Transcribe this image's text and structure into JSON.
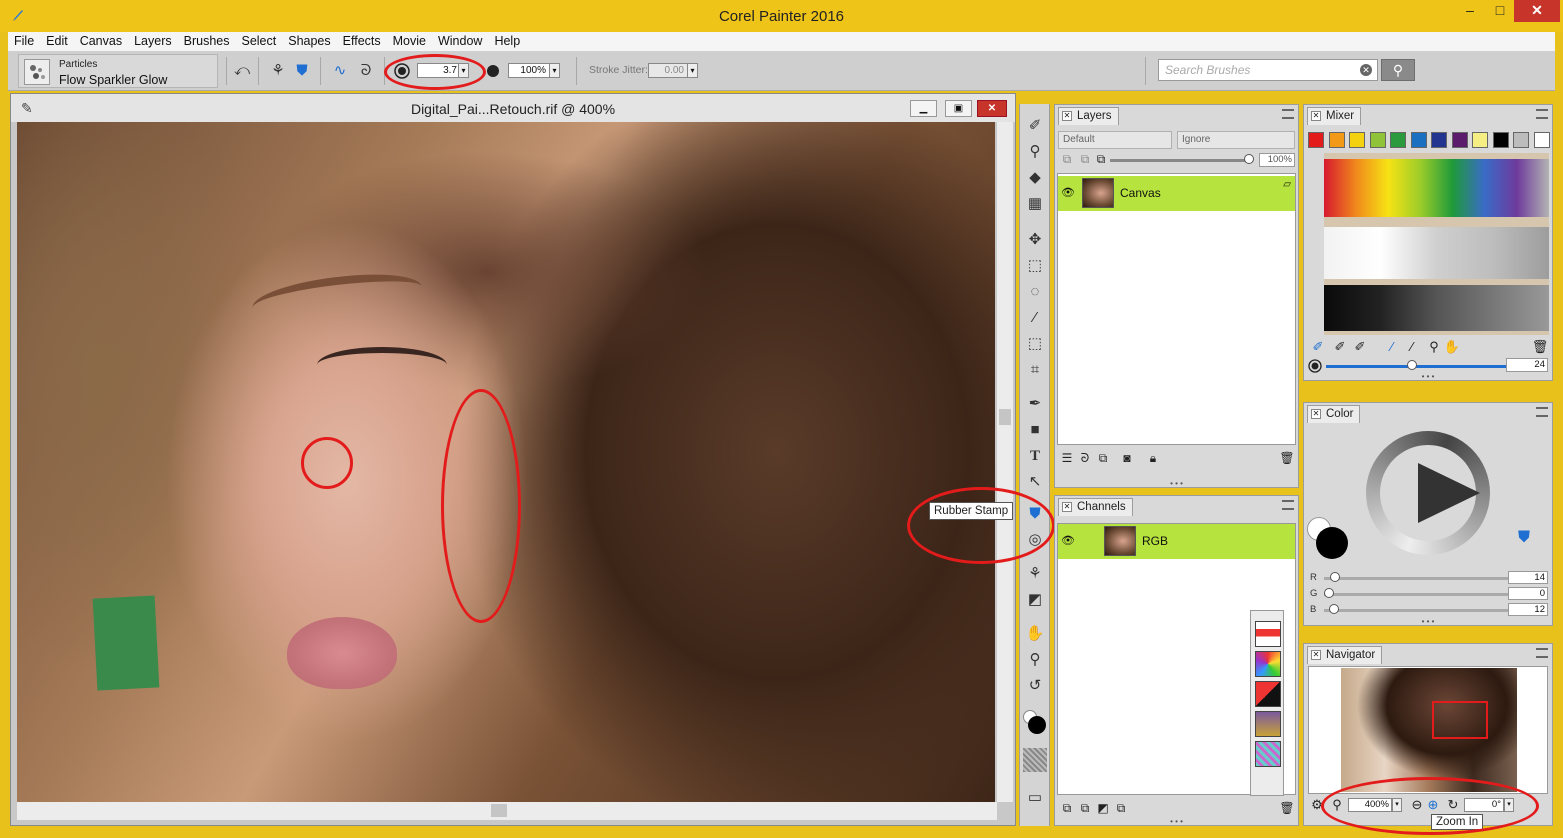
{
  "app": {
    "title": "Corel Painter 2016"
  },
  "menu": [
    "File",
    "Edit",
    "Canvas",
    "Layers",
    "Brushes",
    "Select",
    "Shapes",
    "Effects",
    "Movie",
    "Window",
    "Help"
  ],
  "property_bar": {
    "brush_category": "Particles",
    "brush_variant": "Flow Sparkler Glow",
    "size_value": "3.7",
    "opacity_value": "100%",
    "stroke_jitter_label": "Stroke Jitter:",
    "stroke_jitter_value": "0.00",
    "search_placeholder": "Search Brushes"
  },
  "document": {
    "title": "Digital_Pai...Retouch.rif @ 400%"
  },
  "toolbox": {
    "tooltip": "Rubber Stamp",
    "tools": [
      "brush-icon",
      "dropper-icon",
      "paint-bucket-icon",
      "eraser-icon",
      "transform-icon",
      "rect-select-icon",
      "lasso-icon",
      "magic-wand-icon",
      "select-adjuster-icon",
      "crop-icon",
      "pen-icon",
      "rectangle-shape-icon",
      "text-icon",
      "shape-select-icon",
      "rubber-stamp-icon",
      "cloner-icon",
      "mirror-icon",
      "perspective-icon",
      "grabber-icon",
      "magnifier-icon",
      "rotate-page-icon"
    ]
  },
  "layers_panel": {
    "tab": "Layers",
    "composite_method": "Default",
    "composite_depth": "Ignore",
    "opacity": "100%",
    "layers": [
      {
        "name": "Canvas"
      }
    ]
  },
  "channels_panel": {
    "tab": "Channels",
    "channels": [
      {
        "name": "RGB"
      }
    ]
  },
  "mixer_panel": {
    "tab": "Mixer",
    "colors": [
      "#e31b1b",
      "#f29a18",
      "#f5d20f",
      "#8fc33a",
      "#2b9a3e",
      "#1b6fc1",
      "#23358f",
      "#5a1c6b",
      "#f5ee84",
      "#000000",
      "#bcbcbc",
      "#ffffff"
    ],
    "brush_size": "24"
  },
  "color_panel": {
    "tab": "Color",
    "r": {
      "label": "R",
      "value": "14"
    },
    "g": {
      "label": "G",
      "value": "0"
    },
    "b": {
      "label": "B",
      "value": "12"
    }
  },
  "navigator_panel": {
    "tab": "Navigator",
    "zoom": "400%",
    "rotation": "0°",
    "tooltip": "Zoom In"
  },
  "colors": {
    "accent": "#1e6fd1",
    "selected_layer": "#b6e33d",
    "annotation": "#e31b1b",
    "window_frame": "#efc419"
  }
}
